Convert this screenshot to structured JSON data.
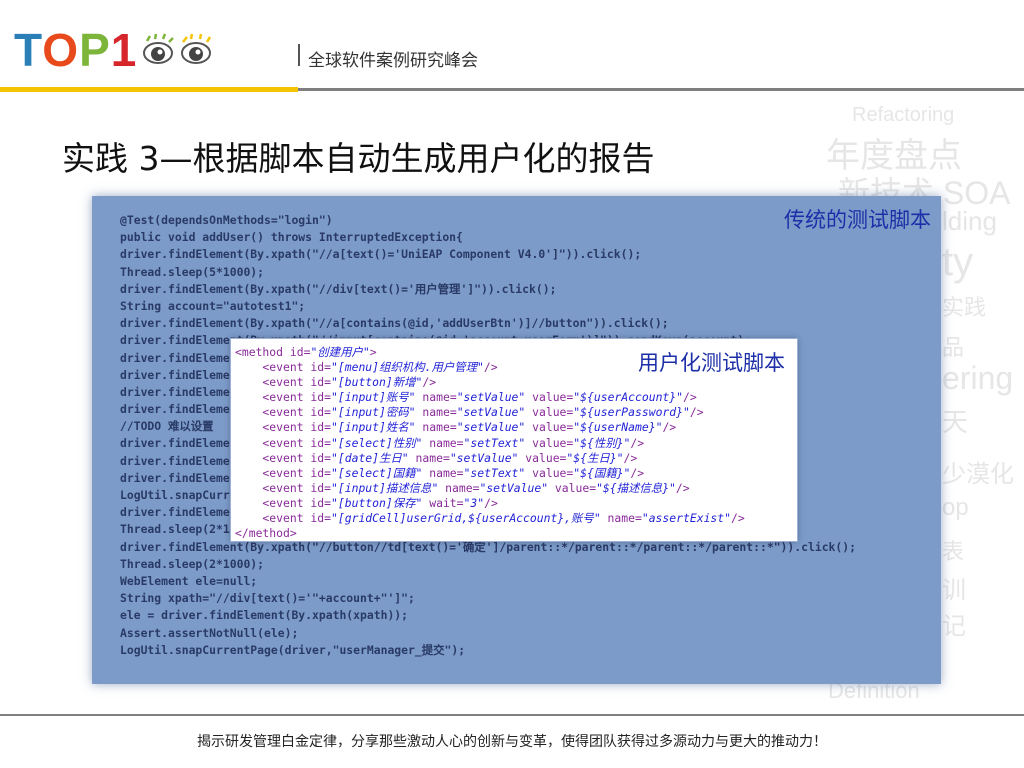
{
  "header": {
    "logo_text": "TOP1",
    "tagline": "全球软件案例研究峰会"
  },
  "watermark": {
    "words": [
      "Refactoring",
      "年度盘点",
      "新技术 SOA",
      "lding",
      "ty",
      "实践",
      "品",
      "ering",
      "天",
      "少漠化",
      "op",
      "表",
      "训",
      "记",
      "Definition"
    ]
  },
  "slide": {
    "title": "实践 3—根据脚本自动生成用户化的报告"
  },
  "code_panel": {
    "label": "传统的测试脚本",
    "lines": [
      "@Test(dependsOnMethods=\"login\")",
      "public void addUser() throws InterruptedException{",
      "driver.findElement(By.xpath(\"//a[text()='UniEAP Component V4.0']\")).click();",
      "Thread.sleep(5*1000);",
      "driver.findElement(By.xpath(\"//div[text()='用户管理']\")).click();",
      "String account=\"autotest1\";",
      "driver.findElement(By.xpath(\"//a[contains(@id,'addUserBtn')]//button\")).click();",
      "driver.findElement(By.xpath(\"//input[contains(@id,'account_userForm')]\")).sendKeys(account);",
      "driver.findElement(By.xpath(\"//input[contains(@id,'password_userForm')]\")).sendKeys(\"1\");",
      "driver.findElement(By.xpath(\"//input[contains(@id,'name_userForm')]\")).sendKeys(account);",
      "driver.findElement(By.xpath(\"//input[contains(@id,'sex')]\")).click();",
      "driver.findElement(By.xpath(\"//div[text()='男']\")).click();",
      "//TODO 难以设置",
      "driver.findElement(By.xpath(\"//input[contains(@id,'birth')]\")).click();",
      "driver.findElement(By.xpath(\"//input[contains(@id,'country')]\")).click();",
      "driver.findElement(By.xpath(\"//textarea[contains(@id,'desc')]\")).sendKeys(\"描述\");",
      "LogUtil.snapCurrentPage(driver,\"userManager_填写\");",
      "driver.findElement(By.xpath(\"//button[text()='保存']\")).click();",
      "Thread.sleep(2*1000);",
      "driver.findElement(By.xpath(\"//button//td[text()='确定']/parent::*/parent::*/parent::*/parent::*\")).click();",
      "Thread.sleep(2*1000);",
      "WebElement ele=null;",
      "String xpath=\"//div[text()='\"+account+\"']\";",
      "ele = driver.findElement(By.xpath(xpath));",
      "Assert.assertNotNull(ele);",
      "LogUtil.snapCurrentPage(driver,\"userManager_提交\");"
    ]
  },
  "xml_box": {
    "label": "用户化测试脚本",
    "lines": [
      "<method id=\"创建用户\">",
      "    <event id=\"[menu]组织机构.用户管理\"/>",
      "    <event id=\"[button]新增\"/>",
      "    <event id=\"[input]账号\" name=\"setValue\" value=\"${userAccount}\"/>",
      "    <event id=\"[input]密码\" name=\"setValue\" value=\"${userPassword}\"/>",
      "    <event id=\"[input]姓名\" name=\"setValue\" value=\"${userName}\"/>",
      "    <event id=\"[select]性别\" name=\"setText\" value=\"${性别}\"/>",
      "    <event id=\"[date]生日\" name=\"setValue\" value=\"${生日}\"/>",
      "    <event id=\"[select]国籍\" name=\"setText\" value=\"${国籍}\"/>",
      "    <event id=\"[input]描述信息\" name=\"setValue\" value=\"${描述信息}\"/>",
      "    <event id=\"[button]保存\" wait=\"3\"/>",
      "    <event id=\"[gridCell]userGrid,${userAccount},账号\" name=\"assertExist\"/>",
      "</method>"
    ]
  },
  "footer": {
    "text": "揭示研发管理白金定律，分享那些激动人心的创新与变革，使得团队获得过多源动力与更大的推动力！"
  },
  "colors": {
    "logo_blue": "#2a7fb7",
    "logo_orange": "#e84a1c",
    "logo_green": "#7db43a",
    "logo_red": "#d6262b",
    "accent_yellow": "#f5c400",
    "panel_blue": "#7c9bc9",
    "label_blue": "#1c2fa8"
  }
}
